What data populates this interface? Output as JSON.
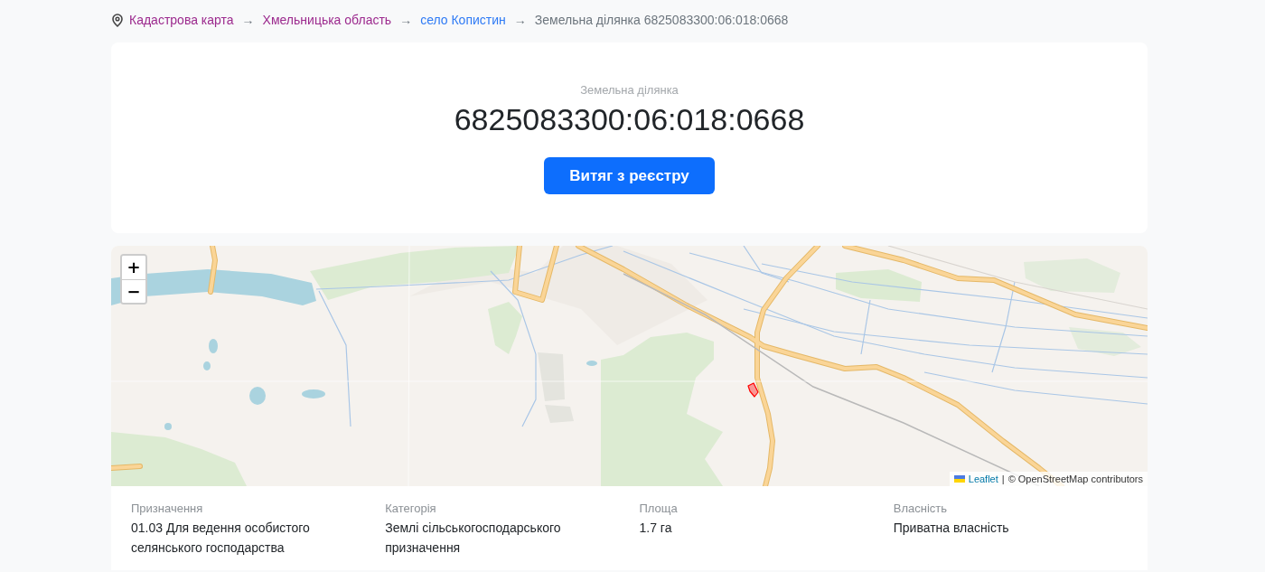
{
  "breadcrumb": {
    "items": [
      {
        "label": "Кадастрова карта",
        "kind": "visited"
      },
      {
        "label": "Хмельницька область",
        "kind": "visited",
        "separator": "→"
      },
      {
        "label": "село Копистин",
        "kind": "link",
        "separator": "→"
      },
      {
        "label": "Земельна ділянка 6825083300:06:018:0668",
        "kind": "current",
        "separator": "→"
      }
    ]
  },
  "parcel": {
    "caption": "Земельна ділянка",
    "cadastral_number": "6825083300:06:018:0668",
    "button": "Витяг з реєстру"
  },
  "map": {
    "zoom_in": "+",
    "zoom_out": "−",
    "attribution": {
      "link": "Leaflet",
      "separator": "|",
      "text": "© OpenStreetMap contributors"
    }
  },
  "details": [
    {
      "label": "Призначення",
      "value": "01.03 Для ведення особистого селянського господарства"
    },
    {
      "label": "Категорія",
      "value": "Землі сільськогосподарського призначення"
    },
    {
      "label": "Площа",
      "value": "1.7 га"
    },
    {
      "label": "Власність",
      "value": "Приватна власність"
    }
  ]
}
